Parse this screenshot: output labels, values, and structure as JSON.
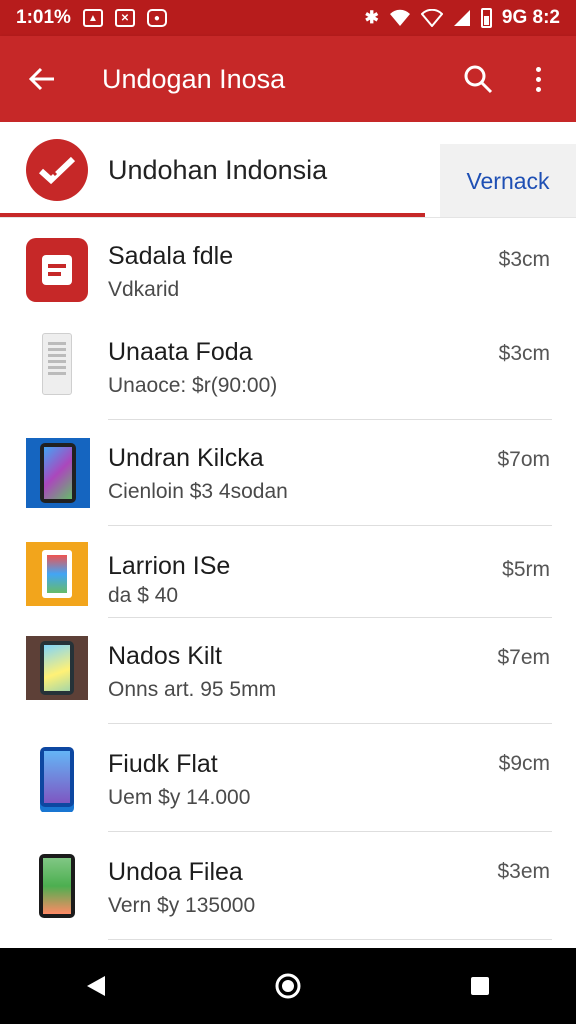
{
  "status_bar": {
    "time": "1:01%",
    "right_text": "9G 8:2"
  },
  "app_bar": {
    "title": "Undogan Inosa",
    "back_icon": "arrow-back-icon",
    "search_icon": "search-icon",
    "more_icon": "more-vert-icon"
  },
  "header": {
    "brand_name": "Undohan Indonsia",
    "link_label": "Vernack"
  },
  "items": [
    {
      "title": "Sadala fdle",
      "subtitle": "Vdkarid",
      "price": "$3cm"
    },
    {
      "title": "Unaata Foda",
      "subtitle": "Unaoce: $r(90:00)",
      "price": "$3cm"
    },
    {
      "title": "Undran Kilcka",
      "subtitle": "Cienloin $3 4sodan",
      "price": "$7om"
    },
    {
      "title": "Larrion ISe",
      "subtitle": "da $ 40",
      "price": "$5rm"
    },
    {
      "title": "Nados Kilt",
      "subtitle": "Onns art. 95 5mm",
      "price": "$7em"
    },
    {
      "title": "Fiudk Flat",
      "subtitle": "Uem $y 14.000",
      "price": "$9cm"
    },
    {
      "title": "Undoa Filea",
      "subtitle": "Vern $y 135000",
      "price": "$3em"
    }
  ],
  "colors": {
    "primary": "#c62828",
    "status": "#b71c1c",
    "link": "#1e4fb4"
  }
}
